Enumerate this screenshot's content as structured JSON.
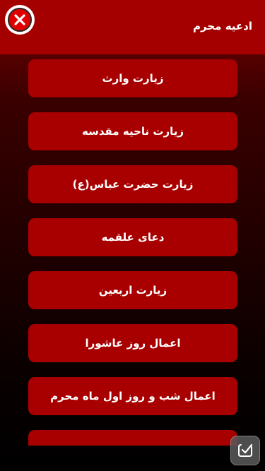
{
  "header": {
    "title": "ادعیه محرم",
    "close_icon": "close-icon"
  },
  "menu": {
    "items": [
      {
        "label": "زیارت وارث"
      },
      {
        "label": "زیارت ناحیه مقدسه"
      },
      {
        "label": "زیارت حضرت عباس(ع)"
      },
      {
        "label": "دعای علقمه"
      },
      {
        "label": "زیارت اربعین"
      },
      {
        "label": "اعمال روز عاشورا"
      },
      {
        "label": "اعمال شب و روز اول ماه محرم"
      },
      {
        "label": ""
      }
    ]
  },
  "overlay": {
    "icon": "check-badge-icon"
  },
  "colors": {
    "header": "#a50000",
    "button": "#a80000",
    "text": "#ffffff",
    "close_red": "#e00000"
  }
}
